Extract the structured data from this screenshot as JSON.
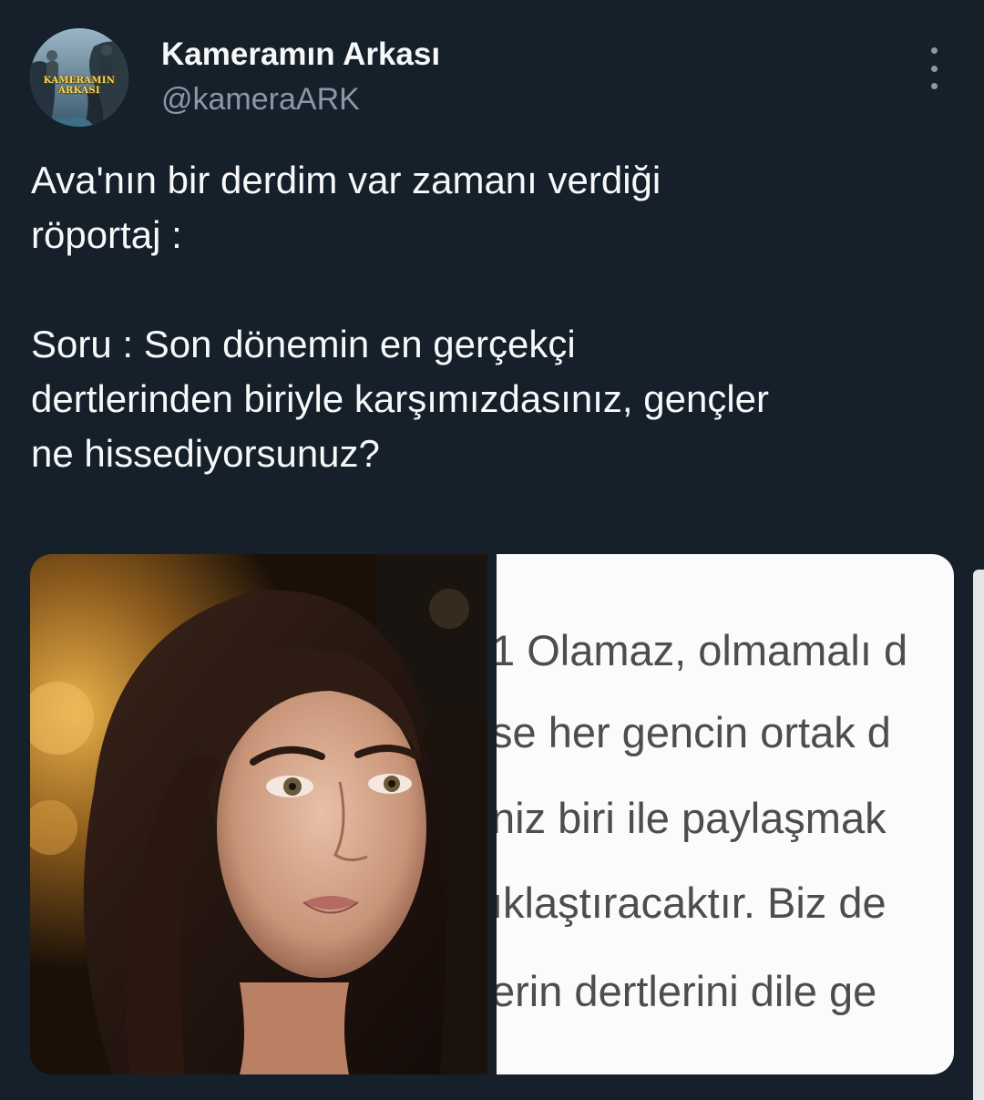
{
  "tweet": {
    "author": {
      "display_name": "Kameramın Arkası",
      "handle": "@kameraARK",
      "avatar_text_line1": "KAMERAMIN",
      "avatar_text_line2": "ARKASI"
    },
    "text_line1": "Ava'nın bir derdim var zamanı verdiği",
    "text_line2": "röportaj :",
    "text_line3": "Soru : Son dönemin en gerçekçi",
    "text_line4": "dertlerinden biriyle karşımızdasınız, gençler",
    "text_line5": "ne hissediyorsunuz?"
  },
  "media": {
    "doc_lines": [
      "1 Olamaz, olmamalı d",
      "se her gencin ortak d",
      "niz biri ile paylaşmak",
      "ıklaştıracaktır. Biz de",
      "erin dertlerini dile ge"
    ]
  },
  "icons": {
    "more": "more-vertical-icon",
    "avatar": "avatar-image"
  },
  "colors": {
    "background": "#15202b",
    "text_primary": "#f7f9f9",
    "text_secondary": "#8b98a5"
  }
}
